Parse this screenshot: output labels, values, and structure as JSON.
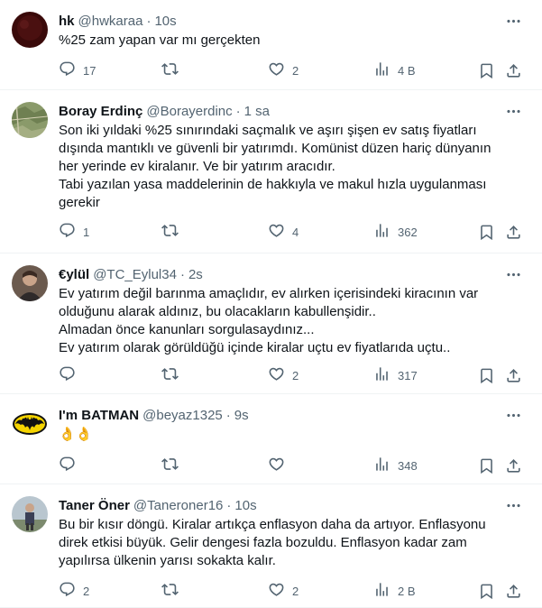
{
  "tweets": [
    {
      "name": "hk",
      "handle": "@hwkaraa",
      "separator": "·",
      "time": "10s",
      "lines": [
        "%25 zam yapan var mı gerçekten"
      ],
      "replies": "17",
      "retweets": "",
      "likes": "2",
      "views": "4 B"
    },
    {
      "name": "Boray Erdinç",
      "handle": "@Borayerdinc",
      "separator": "·",
      "time": "1 sa",
      "lines": [
        "Son iki yıldaki %25 sınırındaki saçmalık ve aşırı şişen ev satış fiyatları",
        "dışında mantıklı ve güvenli bir yatırımdı. Komünist düzen hariç dünyanın",
        "her yerinde ev kiralanır. Ve bir yatırım aracıdır.",
        "Tabi yazılan yasa maddelerinin de hakkıyla ve makul hızla uygulanması",
        "gerekir"
      ],
      "replies": "1",
      "retweets": "",
      "likes": "4",
      "views": "362"
    },
    {
      "name": "€ylül",
      "handle": "@TC_Eylul34",
      "separator": "·",
      "time": "2s",
      "lines": [
        "Ev yatırım değil barınma amaçlıdır, ev alırken içerisindeki kiracının var",
        "olduğunu alarak aldınız, bu olacakların kabullenşidir..",
        "Almadan önce kanunları sorgulasaydınız...",
        "Ev yatırım olarak görüldüğü içinde kiralar uçtu ev fiyatlarıda uçtu.."
      ],
      "replies": "",
      "retweets": "",
      "likes": "2",
      "views": "317"
    },
    {
      "name": "I'm BATMAN",
      "handle": "@beyaz1325",
      "separator": "·",
      "time": "9s",
      "lines": [
        "👌👌"
      ],
      "replies": "",
      "retweets": "",
      "likes": "",
      "views": "348"
    },
    {
      "name": "Taner Öner",
      "handle": "@Taneroner16",
      "separator": "·",
      "time": "10s",
      "lines": [
        "Bu bir kısır döngü. Kiralar artıkça enflasyon daha da artıyor. Enflasyonu",
        "direk etkisi büyük. Gelir dengesi fazla bozuldu. Enflasyon kadar zam",
        "yapılırsa ülkenin yarısı sokakta kalır."
      ],
      "replies": "2",
      "retweets": "",
      "likes": "2",
      "views": "2 B"
    }
  ],
  "icons": {
    "reply": "reply-icon",
    "retweet": "retweet-icon",
    "like": "like-icon",
    "views": "views-icon",
    "bookmark": "bookmark-icon",
    "share": "share-icon",
    "more": "more-icon"
  },
  "colors": {
    "text": "#0f1419",
    "secondary": "#536471",
    "divider": "#eff3f4",
    "batman_yellow": "#f5d400"
  }
}
